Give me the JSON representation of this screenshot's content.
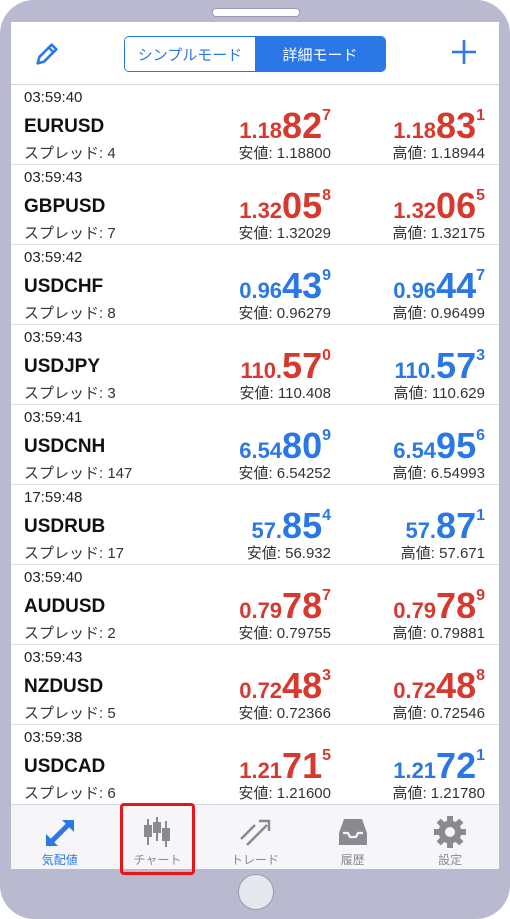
{
  "segment": {
    "simple": "シンプルモード",
    "detail": "詳細モード"
  },
  "quotes": [
    {
      "time": "03:59:40",
      "symbol": "EURUSD",
      "spread": "スプレッド: 4",
      "bid": {
        "p": "1.18",
        "b": "82",
        "s": "7",
        "color": "red"
      },
      "ask": {
        "p": "1.18",
        "b": "83",
        "s": "1",
        "color": "red"
      },
      "low": "安値: 1.18800",
      "high": "高値: 1.18944"
    },
    {
      "time": "03:59:43",
      "symbol": "GBPUSD",
      "spread": "スプレッド: 7",
      "bid": {
        "p": "1.32",
        "b": "05",
        "s": "8",
        "color": "red"
      },
      "ask": {
        "p": "1.32",
        "b": "06",
        "s": "5",
        "color": "red"
      },
      "low": "安値: 1.32029",
      "high": "高値: 1.32175"
    },
    {
      "time": "03:59:42",
      "symbol": "USDCHF",
      "spread": "スプレッド: 8",
      "bid": {
        "p": "0.96",
        "b": "43",
        "s": "9",
        "color": "blue"
      },
      "ask": {
        "p": "0.96",
        "b": "44",
        "s": "7",
        "color": "blue"
      },
      "low": "安値: 0.96279",
      "high": "高値: 0.96499"
    },
    {
      "time": "03:59:43",
      "symbol": "USDJPY",
      "spread": "スプレッド: 3",
      "bid": {
        "p": "110.",
        "b": "57",
        "s": "0",
        "color": "red"
      },
      "ask": {
        "p": "110.",
        "b": "57",
        "s": "3",
        "color": "blue"
      },
      "low": "安値: 110.408",
      "high": "高値: 110.629"
    },
    {
      "time": "03:59:41",
      "symbol": "USDCNH",
      "spread": "スプレッド: 147",
      "bid": {
        "p": "6.54",
        "b": "80",
        "s": "9",
        "color": "blue"
      },
      "ask": {
        "p": "6.54",
        "b": "95",
        "s": "6",
        "color": "blue"
      },
      "low": "安値: 6.54252",
      "high": "高値: 6.54993"
    },
    {
      "time": "17:59:48",
      "symbol": "USDRUB",
      "spread": "スプレッド: 17",
      "bid": {
        "p": "57.",
        "b": "85",
        "s": "4",
        "color": "blue"
      },
      "ask": {
        "p": "57.",
        "b": "87",
        "s": "1",
        "color": "blue"
      },
      "low": "安値: 56.932",
      "high": "高値: 57.671"
    },
    {
      "time": "03:59:40",
      "symbol": "AUDUSD",
      "spread": "スプレッド: 2",
      "bid": {
        "p": "0.79",
        "b": "78",
        "s": "7",
        "color": "red"
      },
      "ask": {
        "p": "0.79",
        "b": "78",
        "s": "9",
        "color": "red"
      },
      "low": "安値: 0.79755",
      "high": "高値: 0.79881"
    },
    {
      "time": "03:59:43",
      "symbol": "NZDUSD",
      "spread": "スプレッド: 5",
      "bid": {
        "p": "0.72",
        "b": "48",
        "s": "3",
        "color": "red"
      },
      "ask": {
        "p": "0.72",
        "b": "48",
        "s": "8",
        "color": "red"
      },
      "low": "安値: 0.72366",
      "high": "高値: 0.72546"
    },
    {
      "time": "03:59:38",
      "symbol": "USDCAD",
      "spread": "スプレッド: 6",
      "bid": {
        "p": "1.21",
        "b": "71",
        "s": "5",
        "color": "red"
      },
      "ask": {
        "p": "1.21",
        "b": "72",
        "s": "1",
        "color": "blue"
      },
      "low": "安値: 1.21600",
      "high": "高値: 1.21780"
    }
  ],
  "tabs": [
    {
      "label": "気配値",
      "icon": "quotes-arrows-icon",
      "active": true
    },
    {
      "label": "チャート",
      "icon": "candlestick-chart-icon",
      "highlighted": true
    },
    {
      "label": "トレード",
      "icon": "trade-icon"
    },
    {
      "label": "履歴",
      "icon": "history-inbox-icon"
    },
    {
      "label": "設定",
      "icon": "settings-gear-icon"
    }
  ],
  "colors": {
    "red": "#d63a2e",
    "blue": "#2a78e6",
    "highlight": "#e8161c"
  }
}
